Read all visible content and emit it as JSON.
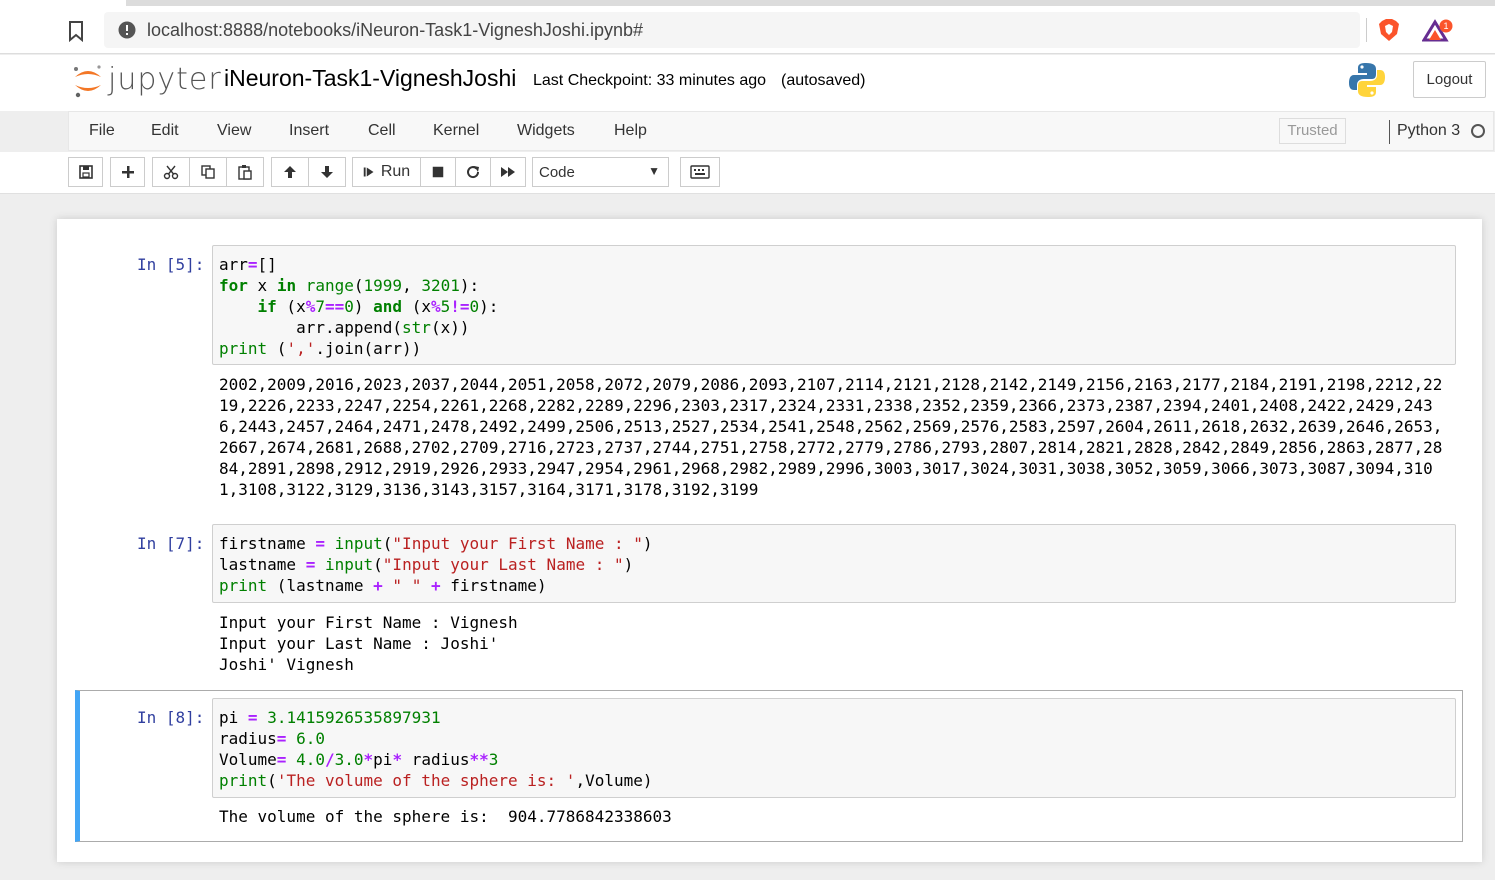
{
  "browser": {
    "url": "localhost:8888/notebooks/iNeuron-Task1-VigneshJoshi.ipynb#",
    "rewards_badge": "1"
  },
  "header": {
    "logo_text": "jupyter",
    "notebook_title": "iNeuron-Task1-VigneshJoshi",
    "checkpoint": "Last Checkpoint: 33 minutes ago",
    "autosave": "(autosaved)",
    "logout_label": "Logout"
  },
  "menubar": {
    "items": [
      "File",
      "Edit",
      "View",
      "Insert",
      "Cell",
      "Kernel",
      "Widgets",
      "Help"
    ],
    "trusted": "Trusted",
    "kernel": "Python 3"
  },
  "toolbar": {
    "run_label": "Run",
    "cell_type": "Code",
    "icons": [
      "save-icon",
      "plus-icon",
      "scissors-icon",
      "copy-icon",
      "paste-icon",
      "arrow-up-icon",
      "arrow-down-icon",
      "step-forward-icon",
      "stop-icon",
      "restart-icon",
      "fast-forward-icon",
      "keyboard-icon"
    ]
  },
  "cells": [
    {
      "prompt": "In [5]:",
      "code": [
        "arr=[]",
        "for x in range(1999, 3201):",
        "    if (x%7==0) and (x%5!=0):",
        "        arr.append(str(x))",
        "print (','.join(arr))"
      ],
      "output": [
        "2002,2009,2016,2023,2037,2044,2051,2058,2072,2079,2086,2093,2107,2114,2121,2128,2142,2149,2156,2163,2177,2184,2191,2198,2212,22",
        "19,2226,2233,2247,2254,2261,2268,2282,2289,2296,2303,2317,2324,2331,2338,2352,2359,2366,2373,2387,2394,2401,2408,2422,2429,243",
        "6,2443,2457,2464,2471,2478,2492,2499,2506,2513,2527,2534,2541,2548,2562,2569,2576,2583,2597,2604,2611,2618,2632,2639,2646,2653,",
        "2667,2674,2681,2688,2702,2709,2716,2723,2737,2744,2751,2758,2772,2779,2786,2793,2807,2814,2821,2828,2842,2849,2856,2863,2877,28",
        "84,2891,2898,2912,2919,2926,2933,2947,2954,2961,2968,2982,2989,2996,3003,3017,3024,3031,3038,3052,3059,3066,3073,3087,3094,310",
        "1,3108,3122,3129,3136,3143,3157,3164,3171,3178,3192,3199"
      ]
    },
    {
      "prompt": "In [7]:",
      "code": [
        "firstname = input(\"Input your First Name : \")",
        "lastname = input(\"Input your Last Name : \")",
        "print (lastname + \" \" + firstname)"
      ],
      "output": [
        "Input your First Name : Vignesh",
        "Input your Last Name : Joshi'",
        "Joshi' Vignesh"
      ]
    },
    {
      "prompt": "In [8]:",
      "code": [
        "pi = 3.1415926535897931",
        "radius= 6.0",
        "Volume= 4.0/3.0*pi* radius**3",
        "print('The volume of the sphere is: ',Volume)"
      ],
      "output": [
        "The volume of the sphere is:  904.7786842338603"
      ]
    }
  ],
  "colors": {
    "prompt": "#303f9f",
    "keyword": "#008000",
    "operator": "#aa22ff",
    "string": "#ba2121",
    "selected_cell": "#42a5f5"
  }
}
